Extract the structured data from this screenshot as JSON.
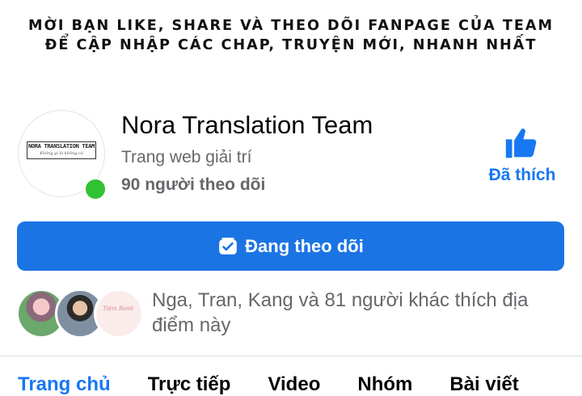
{
  "banner": {
    "line1": "MỜI BẠN LIKE, SHARE VÀ THEO DÕI FANPAGE CỦA TEAM",
    "line2": "ĐỂ CẬP NHẬP CÁC CHAP, TRUYỆN MỚI, NHANH NHẤT"
  },
  "page": {
    "logo_title": "NORA TRANSLATION TEAM",
    "logo_subtitle": "Không gì là không có",
    "name": "Nora Translation Team",
    "category": "Trang web giải trí",
    "followers": "90 người theo dõi",
    "online": true
  },
  "actions": {
    "liked_label": "Đã thích",
    "follow_label": "Đang theo dõi"
  },
  "friends": {
    "text": "Nga, Tran, Kang và 81 người khác thích địa điểm này",
    "third_avatar_text": "Tiệm Bánh"
  },
  "tabs": [
    {
      "label": "Trang chủ",
      "active": true
    },
    {
      "label": "Trực tiếp",
      "active": false
    },
    {
      "label": "Video",
      "active": false
    },
    {
      "label": "Nhóm",
      "active": false
    },
    {
      "label": "Bài viết",
      "active": false
    }
  ],
  "colors": {
    "accent": "#1877f2",
    "button": "#1b74e4",
    "online": "#31c233",
    "secondary_text": "#65676b"
  },
  "icons": {
    "liked": "thumbs-up-icon",
    "follow": "following-inbox-icon"
  }
}
